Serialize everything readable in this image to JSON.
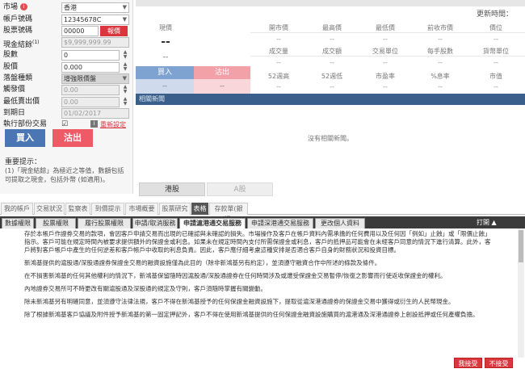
{
  "order": {
    "market_label": "市場",
    "market_value": "香港",
    "account_label": "帳戶號碼",
    "account_value": "12345678C",
    "stock_label": "股票號碼",
    "stock_value": "00000",
    "stock_button": "報價",
    "cash_label": "現金結餘",
    "cash_superscript": "(1)",
    "cash_value": "$9,999,999.99",
    "qty_label": "股數",
    "qty_value": "0",
    "price_label": "股價",
    "price_value": "0.000",
    "order_type_label": "落盤種類",
    "order_type_value": "增強限價盤",
    "trigger_label": "觸發價",
    "trigger_value": "0.00",
    "max_price_label": "最低賣出價",
    "max_price_value": "0.00",
    "expiry_label": "到期日",
    "expiry_value": "01/02/2017",
    "exec_label": "執行部份交易",
    "reset_label": "重新設定",
    "buy_label": "買入",
    "sell_label": "沽出",
    "notes_title": "重要提示：",
    "notes_body": "(1)「現金結餘」為極近之等值，數額包括可提取之現金，包括外幣 (如適用)。"
  },
  "quote": {
    "update_label": "更新時間：",
    "price_label": "現價",
    "price_value": "--",
    "change_value": "--",
    "headers_row1": [
      "開市價",
      "最高價",
      "最低價",
      "前收市價",
      "價位"
    ],
    "headers_row2": [
      "成交量",
      "成交額",
      "交易單位",
      "每手股數",
      "貨幣單位"
    ],
    "headers_row3": [
      "52週高",
      "52週低",
      "市盈率",
      "%息率",
      "市值"
    ],
    "dash": "--",
    "buy_label": "買入",
    "sell_label": "沽出",
    "bid_value": "--",
    "ask_value": "--",
    "news_title": "相關新聞",
    "news_empty": "沒有相關新聞。",
    "tab_hk": "港股",
    "tab_a": "A股"
  },
  "main_tabs": [
    "我的帳戶",
    "交易狀況",
    "監察表",
    "到價提示",
    "市場概要",
    "股票研究",
    "表格",
    "存款單(銀行)"
  ],
  "sub_tabs": [
    "數據權限",
    "股票權限",
    "履行股票權限",
    "申請/取消服務",
    "申請滬港通交易服務",
    "申請深港通交易服務",
    "更改個人資料"
  ],
  "print_label": "打開 ▲",
  "terms": [
    "存於本帳戶作證券交易的款項，會因客戶申請交易而出現的已確認與未確認的損失。市場操作及客戶在帳戶資料內需承擔的任何費用以及任何因「例如」止蝕」或「限價止蝕」指示。客戶可能在規定時間內被要求提供額外的保證金或利息。如果未在規定時間內支付所需保證金或利息，客戶的抵押品可能會在未經客戶同意的情況下進行清算。此外，客戶將對客戶帳戶中產生的任何逆差和客戶帳戶中收取的利息負責。因此，客戶應仔細考慮這種安排是否適合客戶自身的財務狀況和投資目標。",
    "新鴻基提供的滬股通/深股通證券保證金交易的融資設施僅為此目的（除非新鴻基另有約定），並須遵守融資合作中所述的條款及條件。",
    "在不損害新鴻基的任何其他權利的情況下，新鴻基保留隨時因滬股通/深股通證券在任何時間涉及或遭受保證金交易暫停/恢復之影響而行使返收保證金的權利。",
    "內地證券交易所可不時更改有關滬股通及深股通的規定及守則，客戶須隨時掌握有關變動。",
    "除未新鴻基另有明確同意，並須遵守法律法規，客戶不得在新鴻基授予的任何保證金融資設施下，提取從滬深港通證券的保證金交易中獲得或衍生的人民幣現金。",
    "除了根據新鴻基客戶協議及附件授予新鴻基的第一固定押記外，客戶不得在使用新鴻基提供的任何保證金融資設施購買的滬港通及深港通證券上創設抵押或任何產權負擔。"
  ],
  "accept_label": "我接受",
  "reject_label": "不接受",
  "colors": {
    "buy": "#4a77b4",
    "sell": "#ee5a66",
    "news_header": "#3a5f8a",
    "sub_tab_bar": "#3b3b3b"
  }
}
